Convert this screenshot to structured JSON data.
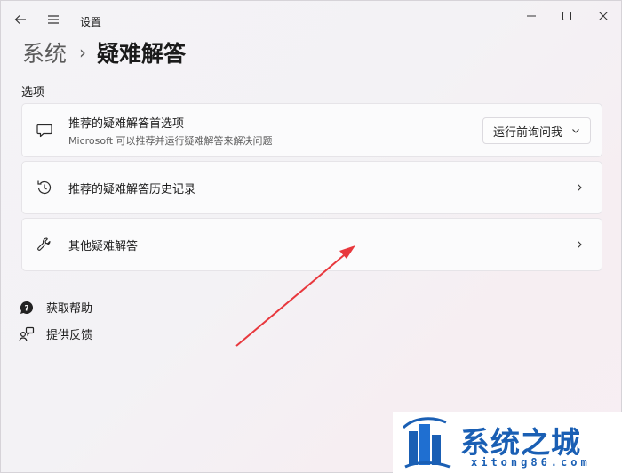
{
  "titlebar": {
    "title": "设置"
  },
  "breadcrumb": {
    "parent": "系统",
    "separator": "›",
    "current": "疑难解答"
  },
  "section_label": "选项",
  "cards": [
    {
      "title": "推荐的疑难解答首选项",
      "subtitle": "Microsoft 可以推荐并运行疑难解答来解决问题",
      "icon": "chat-icon",
      "dropdown_value": "运行前询问我"
    },
    {
      "title": "推荐的疑难解答历史记录",
      "icon": "history-icon"
    },
    {
      "title": "其他疑难解答",
      "icon": "wrench-icon"
    }
  ],
  "links": [
    {
      "label": "获取帮助",
      "icon": "help-icon"
    },
    {
      "label": "提供反馈",
      "icon": "feedback-icon"
    }
  ],
  "watermark": {
    "title": "系统之城",
    "subtitle": "xitong86.com"
  },
  "colors": {
    "annotation_arrow": "#e8383d",
    "watermark_brand": "#1a5fb4"
  }
}
